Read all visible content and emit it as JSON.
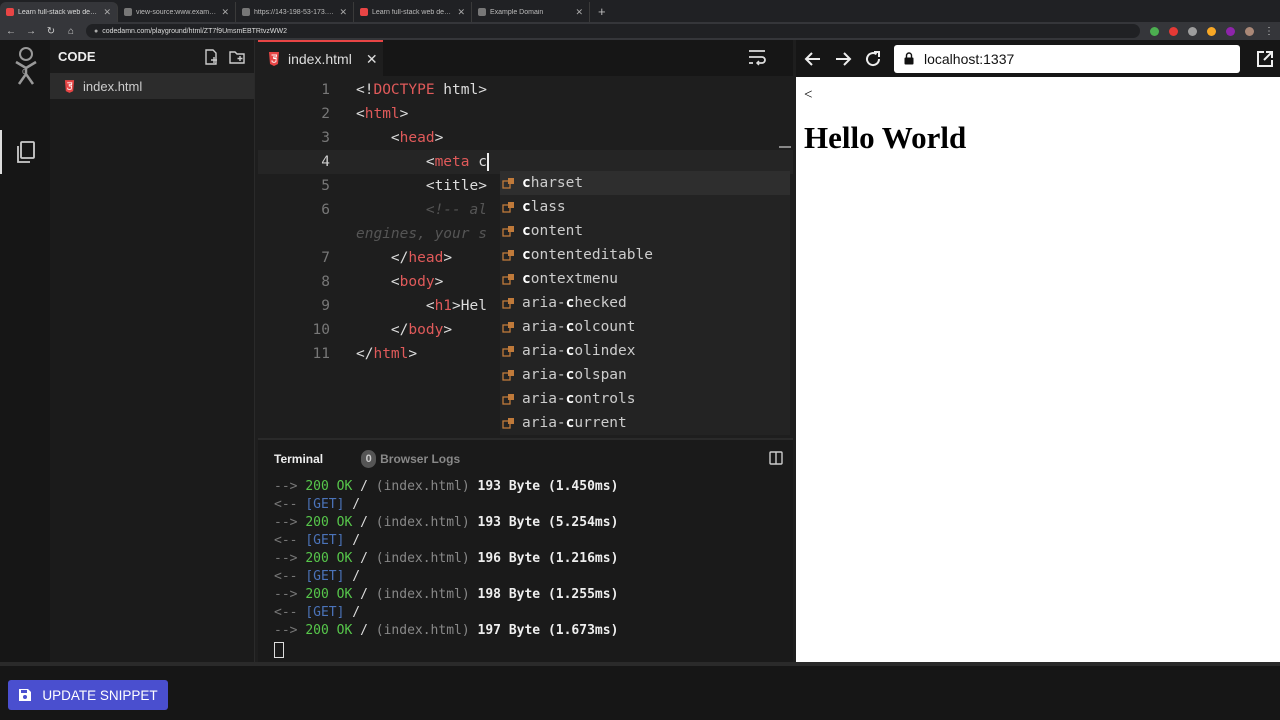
{
  "browser": {
    "tabs": [
      {
        "label": "Learn full-stack web developm",
        "active": true,
        "favicon_color": "#e84545"
      },
      {
        "label": "view-source:www.example.com",
        "active": false,
        "favicon_color": "#777777"
      },
      {
        "label": "https://143-198-53-173.dns.c",
        "active": false,
        "favicon_color": "#777777"
      },
      {
        "label": "Learn full-stack web developm",
        "active": false,
        "favicon_color": "#e84545"
      },
      {
        "label": "Example Domain",
        "active": false,
        "favicon_color": "#777777"
      }
    ],
    "url": "codedamn.com/playground/html/ZT7f9UmsmEBTRtvzWW2"
  },
  "explorer": {
    "title": "CODE",
    "files": [
      {
        "name": "index.html"
      }
    ]
  },
  "editor": {
    "tab_label": "index.html",
    "lines": [
      {
        "n": "1",
        "parts": [
          [
            "p",
            "<!"
          ],
          [
            "t",
            "DOCTYPE"
          ],
          [
            "p",
            " html>"
          ]
        ]
      },
      {
        "n": "2",
        "parts": [
          [
            "p",
            "<"
          ],
          [
            "t",
            "html"
          ],
          [
            "p",
            ">"
          ]
        ]
      },
      {
        "n": "3",
        "parts": [
          [
            "p",
            "    <"
          ],
          [
            "t",
            "head"
          ],
          [
            "p",
            ">"
          ]
        ]
      },
      {
        "n": "4",
        "parts": [
          [
            "p",
            "        <"
          ],
          [
            "t",
            "meta"
          ],
          [
            "p",
            " c"
          ]
        ],
        "current": true
      },
      {
        "n": "5",
        "parts": [
          [
            "p",
            "        <title>"
          ]
        ]
      },
      {
        "n": "6",
        "parts": [
          [
            "c",
            "        <!-- al"
          ]
        ]
      },
      {
        "n": "",
        "parts": [
          [
            "c",
            "engines, your s"
          ]
        ]
      },
      {
        "n": "7",
        "parts": [
          [
            "p",
            "    </"
          ],
          [
            "t",
            "head"
          ],
          [
            "p",
            ">"
          ]
        ]
      },
      {
        "n": "8",
        "parts": [
          [
            "p",
            "    <"
          ],
          [
            "t",
            "body"
          ],
          [
            "p",
            ">"
          ]
        ]
      },
      {
        "n": "9",
        "parts": [
          [
            "p",
            "        <"
          ],
          [
            "t",
            "h1"
          ],
          [
            "p",
            ">Hel"
          ]
        ]
      },
      {
        "n": "10",
        "parts": [
          [
            "p",
            "    </"
          ],
          [
            "t",
            "body"
          ],
          [
            "p",
            ">"
          ]
        ]
      },
      {
        "n": "11",
        "parts": [
          [
            "p",
            "</"
          ],
          [
            "t",
            "html"
          ],
          [
            "p",
            ">"
          ]
        ]
      }
    ],
    "suggestions": [
      {
        "pre": "",
        "hl": "c",
        "post": "harset",
        "selected": true
      },
      {
        "pre": "",
        "hl": "c",
        "post": "lass"
      },
      {
        "pre": "",
        "hl": "c",
        "post": "ontent"
      },
      {
        "pre": "",
        "hl": "c",
        "post": "ontenteditable"
      },
      {
        "pre": "",
        "hl": "c",
        "post": "ontextmenu"
      },
      {
        "pre": "aria-",
        "hl": "c",
        "post": "hecked"
      },
      {
        "pre": "aria-",
        "hl": "c",
        "post": "olcount"
      },
      {
        "pre": "aria-",
        "hl": "c",
        "post": "olindex"
      },
      {
        "pre": "aria-",
        "hl": "c",
        "post": "olspan"
      },
      {
        "pre": "aria-",
        "hl": "c",
        "post": "ontrols"
      },
      {
        "pre": "aria-",
        "hl": "c",
        "post": "urrent"
      }
    ]
  },
  "terminal": {
    "tab_terminal": "Terminal",
    "tab_logs": "Browser Logs",
    "logs_count": "0",
    "lines": [
      {
        "kind": "res",
        "arrow": "-->",
        "status": "200 OK",
        "path": "/",
        "file": "(index.html)",
        "size": "193 Byte (1.450ms)"
      },
      {
        "kind": "req",
        "arrow": "<--",
        "method": "[GET]",
        "path": "/"
      },
      {
        "kind": "res",
        "arrow": "-->",
        "status": "200 OK",
        "path": "/",
        "file": "(index.html)",
        "size": "193 Byte (5.254ms)"
      },
      {
        "kind": "req",
        "arrow": "<--",
        "method": "[GET]",
        "path": "/"
      },
      {
        "kind": "res",
        "arrow": "-->",
        "status": "200 OK",
        "path": "/",
        "file": "(index.html)",
        "size": "196 Byte (1.216ms)"
      },
      {
        "kind": "req",
        "arrow": "<--",
        "method": "[GET]",
        "path": "/"
      },
      {
        "kind": "res",
        "arrow": "-->",
        "status": "200 OK",
        "path": "/",
        "file": "(index.html)",
        "size": "198 Byte (1.255ms)"
      },
      {
        "kind": "req",
        "arrow": "<--",
        "method": "[GET]",
        "path": "/"
      },
      {
        "kind": "res",
        "arrow": "-->",
        "status": "200 OK",
        "path": "/",
        "file": "(index.html)",
        "size": "197 Byte (1.673ms)"
      }
    ]
  },
  "preview": {
    "url": "localhost:1337",
    "text": "<",
    "heading": "Hello World"
  },
  "footer": {
    "update_label": "UPDATE SNIPPET"
  },
  "colors": {
    "accent": "#4a4fcf",
    "tag": "#e05a5a",
    "ok": "#57c74b",
    "get": "#4b73b9"
  }
}
